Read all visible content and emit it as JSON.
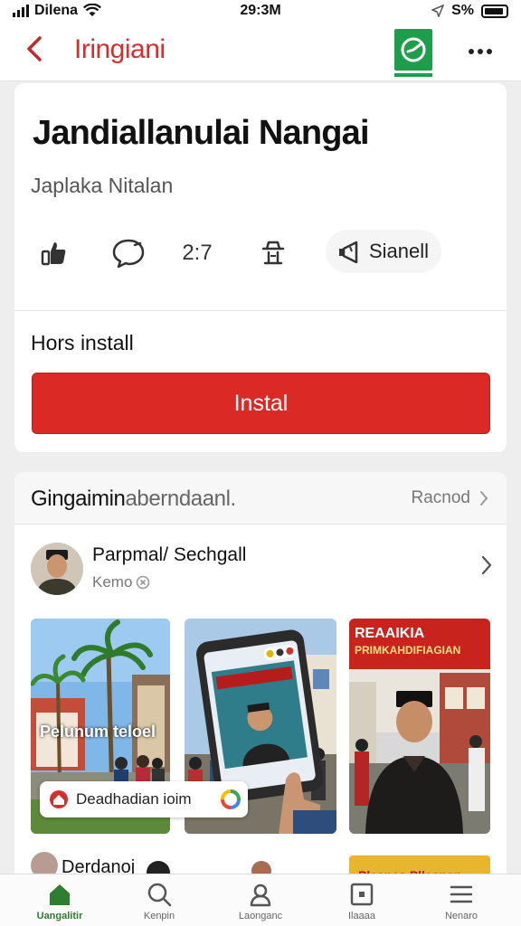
{
  "status_bar": {
    "carrier": "Dilena",
    "time": "29:3M",
    "battery": "S%"
  },
  "header": {
    "title": "Iringiani"
  },
  "post": {
    "title": "Jandiallanulai Nangai",
    "subtitle": "Japlaka Nitalan",
    "comment_count": "2:7",
    "sound_label": "Sianell",
    "install_caption": "Hors install",
    "install_button": "Instal"
  },
  "section": {
    "title_main": "Gingaimin",
    "title_rest": "aberndaanl.",
    "more_label": "Racnod",
    "author": {
      "name": "Parpmal/ Sechgall",
      "meta": "Kemo"
    },
    "thumbnails": [
      {
        "caption": "Pelunum teloel"
      },
      {
        "caption": ""
      },
      {
        "caption": "REAAIKIA",
        "subcaption": "PRIMKAHDIFIAGIAN"
      }
    ],
    "tag_overlay": "Deadhadian ioim",
    "next_author": "Derdanoj",
    "next_banner": "Pleanea Plleanan"
  },
  "bottom_nav": [
    {
      "label": "Uangalitir"
    },
    {
      "label": "Kenpin"
    },
    {
      "label": "Laonganc"
    },
    {
      "label": "Ilaaaa"
    },
    {
      "label": "Nenaro"
    }
  ],
  "colors": {
    "accent_red": "#db2a26",
    "logo_green": "#1e9e4a",
    "nav_active": "#2e7d32"
  }
}
